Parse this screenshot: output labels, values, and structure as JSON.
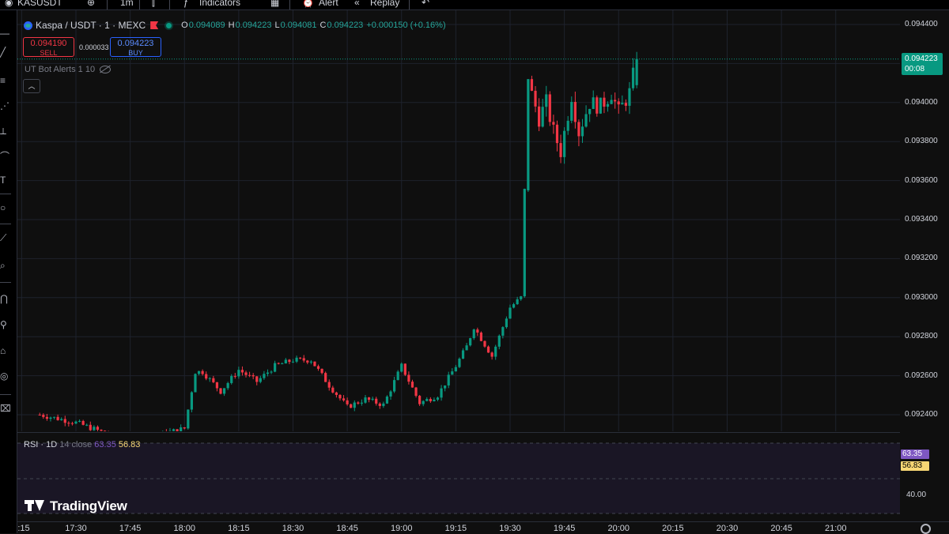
{
  "topbar": {
    "symbol": "KASUSDT",
    "interval": "1m",
    "indicators_label": "Indicators",
    "alert_label": "Alert",
    "replay_label": "Replay"
  },
  "legend": {
    "title": "Kaspa / USDT · 1 · MEXC",
    "open_key": "O",
    "open": "0.094089",
    "high_key": "H",
    "high": "0.094223",
    "low_key": "L",
    "low": "0.094081",
    "close_key": "C",
    "close": "0.094223",
    "change": "+0.000150 (+0.16%)"
  },
  "trade": {
    "sell_price": "0.094190",
    "sell_label": "SELL",
    "spread": "0.000033",
    "buy_price": "0.094223",
    "buy_label": "BUY"
  },
  "indicator": {
    "label": "UT Bot Alerts 1 10"
  },
  "last_price": {
    "price": "0.094223",
    "countdown": "00:08"
  },
  "price_axis": [
    "0.094400",
    "0.094223",
    "0.094000",
    "0.093800",
    "0.093600",
    "0.093400",
    "0.093200",
    "0.093000",
    "0.092800",
    "0.092600",
    "0.092400"
  ],
  "rsi": {
    "name": "RSI · 1D",
    "params": "14 close",
    "value_a": "63.35",
    "value_b": "56.83",
    "axis_label": "40.00"
  },
  "watermark": "TradingView",
  "time_axis": [
    ":15",
    "17:30",
    "17:45",
    "18:00",
    "18:15",
    "18:30",
    "18:45",
    "19:00",
    "19:15",
    "19:30",
    "19:45",
    "20:00",
    "20:15",
    "20:30",
    "20:45",
    "21:00"
  ],
  "colors": {
    "up": "#089981",
    "down": "#f23645",
    "background": "#0f0f0f",
    "rsi_a": "#7e57c2",
    "rsi_b": "#f7d774"
  },
  "chart_data": {
    "type": "candlestick",
    "x_unit": "time (1 minute bars)",
    "ylim": [
      0.0923,
      0.0945
    ],
    "last": 0.094223,
    "anchors": [
      [
        "17:20",
        0.0924
      ],
      [
        "17:30",
        0.09236
      ],
      [
        "17:45",
        0.09226
      ],
      [
        "18:00",
        0.09233
      ],
      [
        "18:03",
        0.09262
      ],
      [
        "18:05",
        0.09262
      ],
      [
        "18:10",
        0.09252
      ],
      [
        "18:15",
        0.09263
      ],
      [
        "18:20",
        0.09257
      ],
      [
        "18:25",
        0.09265
      ],
      [
        "18:30",
        0.09268
      ],
      [
        "18:35",
        0.09268
      ],
      [
        "18:40",
        0.09255
      ],
      [
        "18:45",
        0.09244
      ],
      [
        "18:50",
        0.09248
      ],
      [
        "18:55",
        0.09245
      ],
      [
        "19:00",
        0.09265
      ],
      [
        "19:05",
        0.09246
      ],
      [
        "19:10",
        0.0925
      ],
      [
        "19:15",
        0.09265
      ],
      [
        "19:18",
        0.09275
      ],
      [
        "19:20",
        0.09285
      ],
      [
        "19:25",
        0.0927
      ],
      [
        "19:30",
        0.09295
      ],
      [
        "19:33",
        0.093
      ],
      [
        "19:35",
        0.0941
      ],
      [
        "19:38",
        0.09392
      ],
      [
        "19:40",
        0.094
      ],
      [
        "19:42",
        0.09385
      ],
      [
        "19:44",
        0.09375
      ],
      [
        "19:47",
        0.09404
      ],
      [
        "19:49",
        0.09385
      ],
      [
        "19:52",
        0.094
      ],
      [
        "19:55",
        0.09398
      ],
      [
        "19:58",
        0.09405
      ],
      [
        "20:00",
        0.09395
      ],
      [
        "20:03",
        0.09405
      ],
      [
        "20:05",
        0.094223
      ]
    ],
    "rsi": {
      "line_a": 63.35,
      "line_b": 56.83,
      "bands": [
        70,
        50,
        30
      ]
    }
  }
}
